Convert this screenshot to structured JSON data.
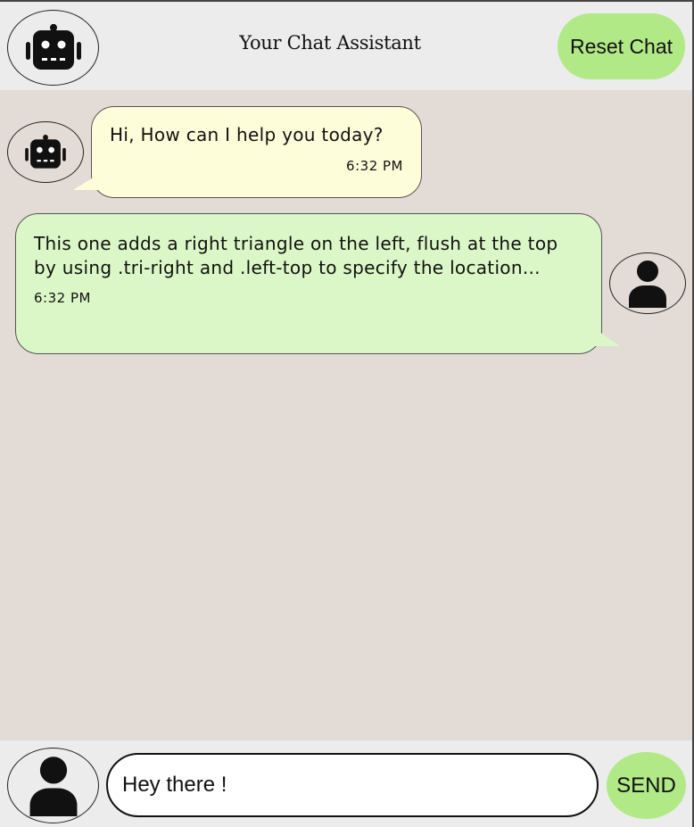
{
  "header": {
    "avatar_icon": "robot-icon",
    "title": "Your Chat Assistant",
    "reset_label": "Reset Chat"
  },
  "messages": [
    {
      "sender": "bot",
      "avatar_icon": "robot-icon",
      "text": "Hi, How can I help you today?",
      "time": "6:32 PM"
    },
    {
      "sender": "user",
      "avatar_icon": "user-icon",
      "text": "This one adds a right triangle on the left, flush at the top by using .tri-right and .left-top to specify the location...",
      "time": "6:32 PM"
    }
  ],
  "composer": {
    "avatar_icon": "user-icon",
    "input_value": "Hey there !",
    "send_label": "SEND"
  },
  "colors": {
    "header_bg": "#ececec",
    "chat_bg": "#e3dbd6",
    "bot_bubble": "#fefdd9",
    "user_bubble": "#dcf7c7",
    "button": "#b2e987"
  }
}
